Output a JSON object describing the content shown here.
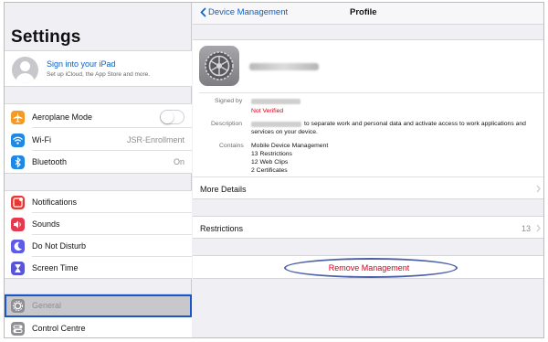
{
  "left": {
    "title": "Settings",
    "profile": {
      "title": "Sign into your iPad",
      "subtitle": "Set up iCloud, the App Store and more."
    },
    "group1": [
      {
        "label": "Aeroplane Mode",
        "icon": "airplane-icon",
        "color": "#f59a23",
        "value": "",
        "toggle": true,
        "toggle_on": false
      },
      {
        "label": "Wi-Fi",
        "icon": "wifi-icon",
        "color": "#1e88e5",
        "value": "JSR-Enrollment"
      },
      {
        "label": "Bluetooth",
        "icon": "bluetooth-icon",
        "color": "#1e88e5",
        "value": "On"
      }
    ],
    "group2": [
      {
        "label": "Notifications",
        "icon": "notifications-icon",
        "color": "#e53935"
      },
      {
        "label": "Sounds",
        "icon": "sounds-icon",
        "color": "#e53950"
      },
      {
        "label": "Do Not Disturb",
        "icon": "moon-icon",
        "color": "#5e5ce6"
      },
      {
        "label": "Screen Time",
        "icon": "hourglass-icon",
        "color": "#5856d6"
      }
    ],
    "group3": [
      {
        "label": "General",
        "icon": "gear-icon",
        "color": "#8e8e93",
        "selected": true
      },
      {
        "label": "Control Centre",
        "icon": "control-centre-icon",
        "color": "#8e8e93"
      }
    ]
  },
  "right": {
    "back_label": "Device Management",
    "title": "Profile",
    "details": {
      "signed_by_label": "Signed by",
      "not_verified": "Not Verified",
      "description_label": "Description",
      "description_line1": "to separate work and personal data and activate access to work applications and",
      "description_line2": "services on your device.",
      "contains_label": "Contains",
      "contains": [
        "Mobile Device Management",
        "13 Restrictions",
        "12 Web Clips",
        "2 Certificates"
      ]
    },
    "more_details": "More Details",
    "restrictions_label": "Restrictions",
    "restrictions_value": "13",
    "remove_management": "Remove Management"
  },
  "colors": {
    "accent": "#0a60c2",
    "destructive": "#d0021b",
    "selection_border": "#1a56c9",
    "annotation_ellipse": "#4a5fa8"
  }
}
